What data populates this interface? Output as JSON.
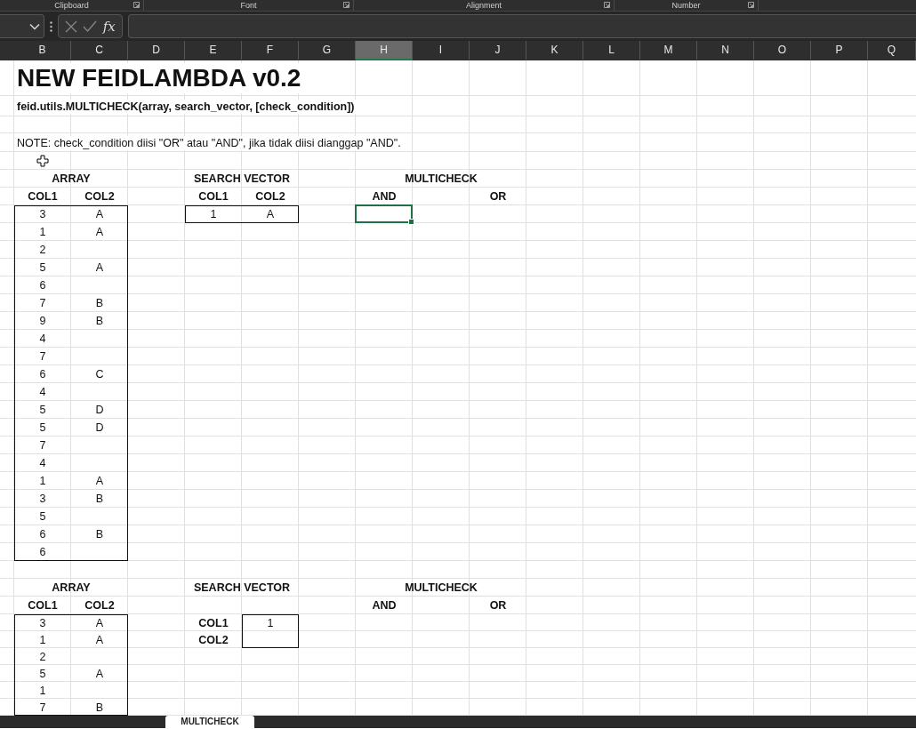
{
  "ribbon_groups": [
    {
      "label": "Clipboard"
    },
    {
      "label": "Font"
    },
    {
      "label": "Alignment"
    },
    {
      "label": "Number"
    }
  ],
  "formula_bar": {
    "function_symbol": "fx"
  },
  "column_headers": [
    {
      "label": "B",
      "selected": false
    },
    {
      "label": "C",
      "selected": false
    },
    {
      "label": "D",
      "selected": false
    },
    {
      "label": "E",
      "selected": false
    },
    {
      "label": "F",
      "selected": false
    },
    {
      "label": "G",
      "selected": false
    },
    {
      "label": "H",
      "selected": true
    },
    {
      "label": "I",
      "selected": false
    },
    {
      "label": "J",
      "selected": false
    },
    {
      "label": "K",
      "selected": false
    },
    {
      "label": "L",
      "selected": false
    },
    {
      "label": "M",
      "selected": false
    },
    {
      "label": "N",
      "selected": false
    },
    {
      "label": "O",
      "selected": false
    },
    {
      "label": "P",
      "selected": false
    },
    {
      "label": "Q",
      "selected": false
    }
  ],
  "title": "NEW FEIDLAMBDA v0.2",
  "signature": "feid.utils.MULTICHECK(array, search_vector, [check_condition])",
  "note": "NOTE: check_condition diisi \"OR\" atau \"AND\", jika tidak diisi dianggap \"AND\".",
  "examples": [
    {
      "kind": "horizontal",
      "array": {
        "title": "ARRAY",
        "columns": [
          "COL1",
          "COL2"
        ],
        "rows": [
          [
            "3",
            "A"
          ],
          [
            "1",
            "A"
          ],
          [
            "2"
          ],
          [
            "5",
            "A"
          ],
          [
            "6"
          ],
          [
            "7",
            "B"
          ],
          [
            "9",
            "B"
          ],
          [
            "4"
          ],
          [
            "7"
          ],
          [
            "6",
            "C"
          ],
          [
            "4"
          ],
          [
            "5",
            "D"
          ],
          [
            "5",
            "D"
          ],
          [
            "7"
          ],
          [
            "4"
          ],
          [
            "1",
            "A"
          ],
          [
            "3",
            "B"
          ],
          [
            "5"
          ],
          [
            "6",
            "B"
          ],
          [
            "6"
          ]
        ]
      },
      "search_vector": {
        "title": "SEARCH VECTOR",
        "fields": [
          {
            "label": "COL1",
            "value": "1"
          },
          {
            "label": "COL2",
            "value": "A"
          }
        ]
      },
      "multicheck": {
        "title": "MULTICHECK",
        "columns": [
          {
            "label": "AND",
            "selected": true
          },
          {
            "label": "OR",
            "selected": false
          }
        ]
      }
    },
    {
      "kind": "vertical",
      "array": {
        "title": "ARRAY",
        "columns": [
          "COL1",
          "COL2"
        ],
        "rows": [
          [
            "3",
            "A"
          ],
          [
            "1",
            "A"
          ],
          [
            "2"
          ],
          [
            "5",
            "A"
          ],
          [
            "1"
          ],
          [
            "7",
            "B"
          ]
        ]
      },
      "search_vector": {
        "title": "SEARCH VECTOR",
        "fields": [
          {
            "label": "COL1",
            "value": "1"
          },
          {
            "label": "COL2"
          }
        ]
      },
      "multicheck": {
        "title": "MULTICHECK",
        "columns": [
          {
            "label": "AND",
            "selected": false
          },
          {
            "label": "OR",
            "selected": false
          }
        ]
      }
    }
  ],
  "sheet_tabs": [
    {
      "label": "MULTICHECK",
      "selected": true
    }
  ]
}
